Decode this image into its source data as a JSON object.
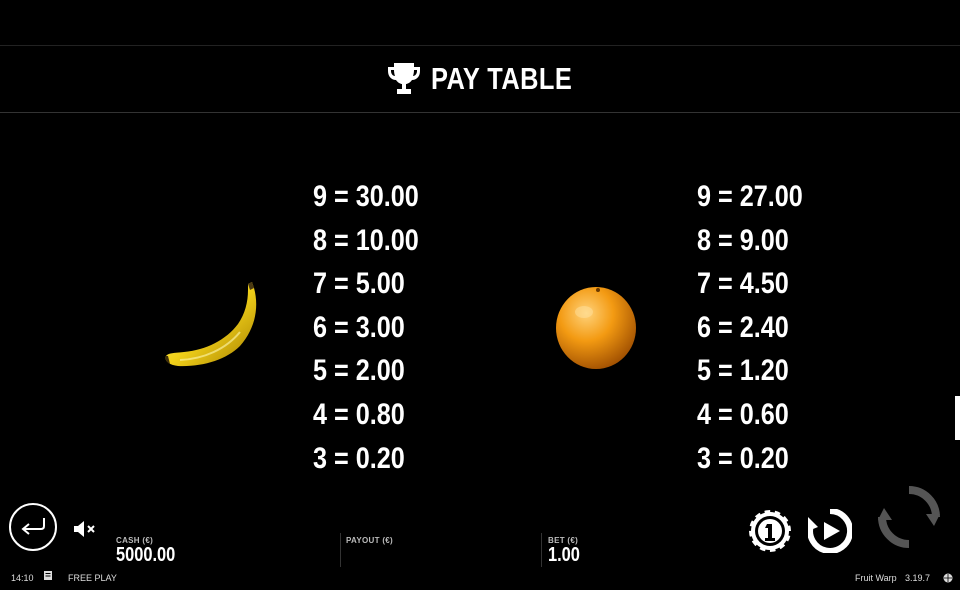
{
  "header": {
    "title": "PAY TABLE",
    "icon": "trophy-icon"
  },
  "paytable": [
    {
      "symbol": "banana",
      "payouts": [
        "9 = 30.00",
        "8 = 10.00",
        "7 = 5.00",
        "6 = 3.00",
        "5 = 2.00",
        "4 = 0.80",
        "3 = 0.20"
      ]
    },
    {
      "symbol": "orange",
      "payouts": [
        "9 = 27.00",
        "8 = 9.00",
        "7 = 4.50",
        "6 = 2.40",
        "5 = 1.20",
        "4 = 0.60",
        "3 = 0.20"
      ]
    }
  ],
  "bottom_bar": {
    "cash_label": "CASH (€)",
    "cash_value": "5000.00",
    "payout_label": "PAYOUT (€)",
    "payout_value": "",
    "bet_label": "BET (€)",
    "bet_value": "1.00",
    "buttons": [
      "back-icon",
      "mute-icon",
      "bet-chip-icon",
      "autoplay-icon",
      "spin-icon"
    ]
  },
  "footer": {
    "time": "14:10",
    "mode": "FREE PLAY",
    "game_name": "Fruit Warp",
    "version": "3.19.7"
  },
  "colors": {
    "background": "#000000",
    "text": "#ffffff",
    "banana": "#f2d21a",
    "orange": "#f39a12",
    "spin_button": "#555555"
  }
}
